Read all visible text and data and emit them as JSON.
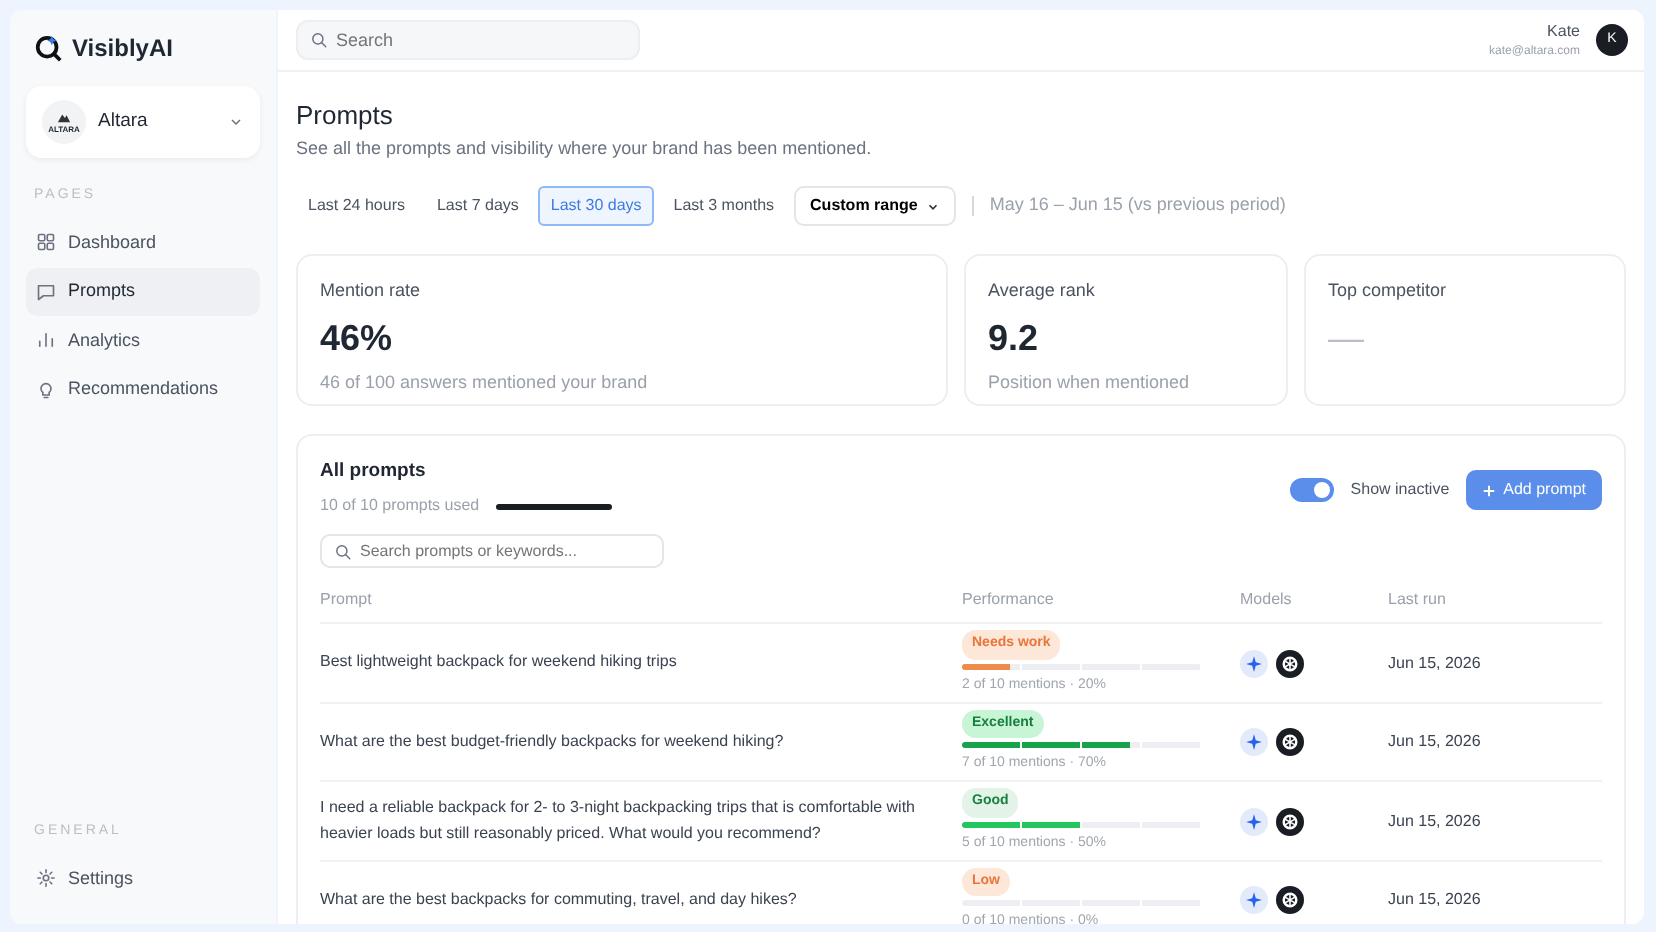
{
  "brand": {
    "name": "VisiblyAI"
  },
  "workspace": {
    "name": "Altara",
    "logo_text": "ALTARA"
  },
  "sidebar": {
    "sections": [
      {
        "heading": "PAGES",
        "items": [
          {
            "label": "Dashboard",
            "selected": false
          },
          {
            "label": "Prompts",
            "selected": true
          },
          {
            "label": "Analytics",
            "selected": false
          },
          {
            "label": "Recommendations",
            "selected": false
          }
        ]
      },
      {
        "heading": "GENERAL",
        "items": [
          {
            "label": "Settings",
            "selected": false
          }
        ]
      }
    ]
  },
  "header": {
    "search_placeholder": "Search",
    "user_name": "Kate",
    "user_email": "kate@altara.com",
    "avatar_initial": "K"
  },
  "page": {
    "title": "Prompts",
    "subtitle": "See all the prompts and visibility where your brand has been mentioned."
  },
  "periods": [
    {
      "label": "Last 24 hours",
      "selected": false
    },
    {
      "label": "Last 7 days",
      "selected": false
    },
    {
      "label": "Last 30 days",
      "selected": true
    },
    {
      "label": "Last 3 months",
      "selected": false
    }
  ],
  "custom_range": "Custom range",
  "range_note": "May 16 – Jun 15 (vs previous period)",
  "stats": [
    {
      "label": "Mention rate",
      "value": "46%",
      "note": "46 of 100 answers mentioned your brand"
    },
    {
      "label": "Average rank",
      "value": "9.2",
      "note": "Position when mentioned"
    },
    {
      "label": "Top competitor",
      "value": "—"
    }
  ],
  "prompts_panel": {
    "title": "All prompts",
    "usage": "10 of 10 prompts used",
    "usage_level": {
      "level": 1
    },
    "show_inactive": {
      "label": "Show inactive",
      "on": true
    },
    "add_button": "Add prompt",
    "search_placeholder": "Search prompts or keywords...",
    "columns": [
      "Prompt",
      "Performance",
      "Models",
      "Last run"
    ],
    "rows": [
      {
        "prompt": "Best lightweight backpack for weekend hiking trips",
        "status": "Needs work",
        "kind": "needs_work",
        "level": 0.2,
        "mentions": "2 of 10 mentions · 20%",
        "last_run": "Jun 15, 2026"
      },
      {
        "prompt": "What are the best budget-friendly backpacks for weekend hiking?",
        "status": "Excellent",
        "kind": "excellent",
        "level": 0.7,
        "mentions": "7 of 10 mentions · 70%",
        "last_run": "Jun 15, 2026"
      },
      {
        "prompt": "I need a reliable backpack for 2- to 3-night backpacking trips that is comfortable with heavier loads but still reasonably priced. What would you recommend?",
        "status": "Good",
        "kind": "good",
        "level": 0.5,
        "mentions": "5 of 10 mentions · 50%",
        "last_run": "Jun 15, 2026"
      },
      {
        "prompt": "What are the best backpacks for commuting, travel, and day hikes?",
        "status": "Low",
        "kind": "low",
        "mentions": "0 of 10 mentions · 0%",
        "last_run": "Jun 15, 2026"
      }
    ]
  }
}
